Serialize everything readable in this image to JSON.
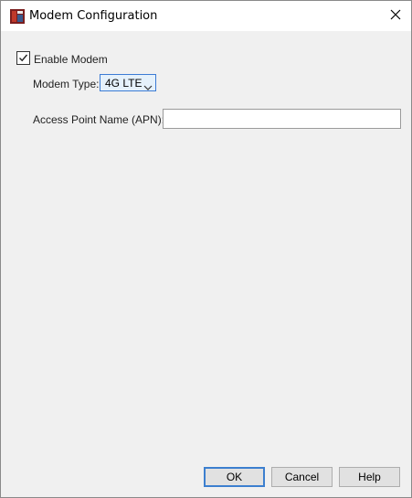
{
  "window": {
    "title": "Modem Configuration",
    "app_icon": "app-logo-icon",
    "close_icon": "close-icon"
  },
  "form": {
    "enable_modem": {
      "label": "Enable Modem",
      "checked": true
    },
    "modem_type": {
      "label": "Modem Type:",
      "value": "4G LTE",
      "options": [
        "4G LTE"
      ]
    },
    "apn": {
      "label": "Access Point Name (APN):",
      "value": "",
      "placeholder": ""
    }
  },
  "buttons": {
    "ok": "OK",
    "cancel": "Cancel",
    "help": "Help"
  },
  "colors": {
    "accent": "#3c7fcf",
    "dialog_bg": "#f0f0f0"
  }
}
